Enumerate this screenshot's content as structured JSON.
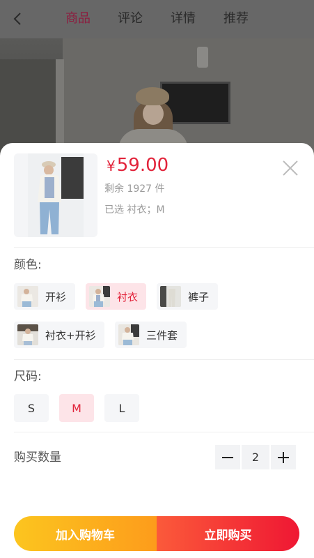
{
  "header": {
    "tabs": [
      {
        "label": "商品",
        "active": true
      },
      {
        "label": "评论",
        "active": false
      },
      {
        "label": "详情",
        "active": false
      },
      {
        "label": "推荐",
        "active": false
      }
    ],
    "back_icon": "chevron-left-icon"
  },
  "product": {
    "currency": "¥",
    "price": "59.00",
    "stock_text": "剩余 1927 件",
    "selected_text": "已选 衬衣；M",
    "close_icon": "close-icon"
  },
  "color_section": {
    "label": "颜色:",
    "options": [
      {
        "label": "开衫",
        "selected": false
      },
      {
        "label": "衬衣",
        "selected": true
      },
      {
        "label": "裤子",
        "selected": false
      },
      {
        "label": "衬衣+开衫",
        "selected": false
      },
      {
        "label": "三件套",
        "selected": false
      }
    ]
  },
  "size_section": {
    "label": "尺码:",
    "options": [
      {
        "label": "S",
        "selected": false
      },
      {
        "label": "M",
        "selected": true
      },
      {
        "label": "L",
        "selected": false
      }
    ]
  },
  "quantity": {
    "label": "购买数量",
    "value": "2",
    "minus_icon": "minus-icon",
    "plus_icon": "plus-icon"
  },
  "actions": {
    "add_to_cart": "加入购物车",
    "buy_now": "立即购买"
  },
  "colors": {
    "accent": "#e2233a",
    "cart_gradient": [
      "#fcc51f",
      "#fd9c1b"
    ],
    "buy_gradient": [
      "#fb5a3a",
      "#ef1733"
    ]
  }
}
